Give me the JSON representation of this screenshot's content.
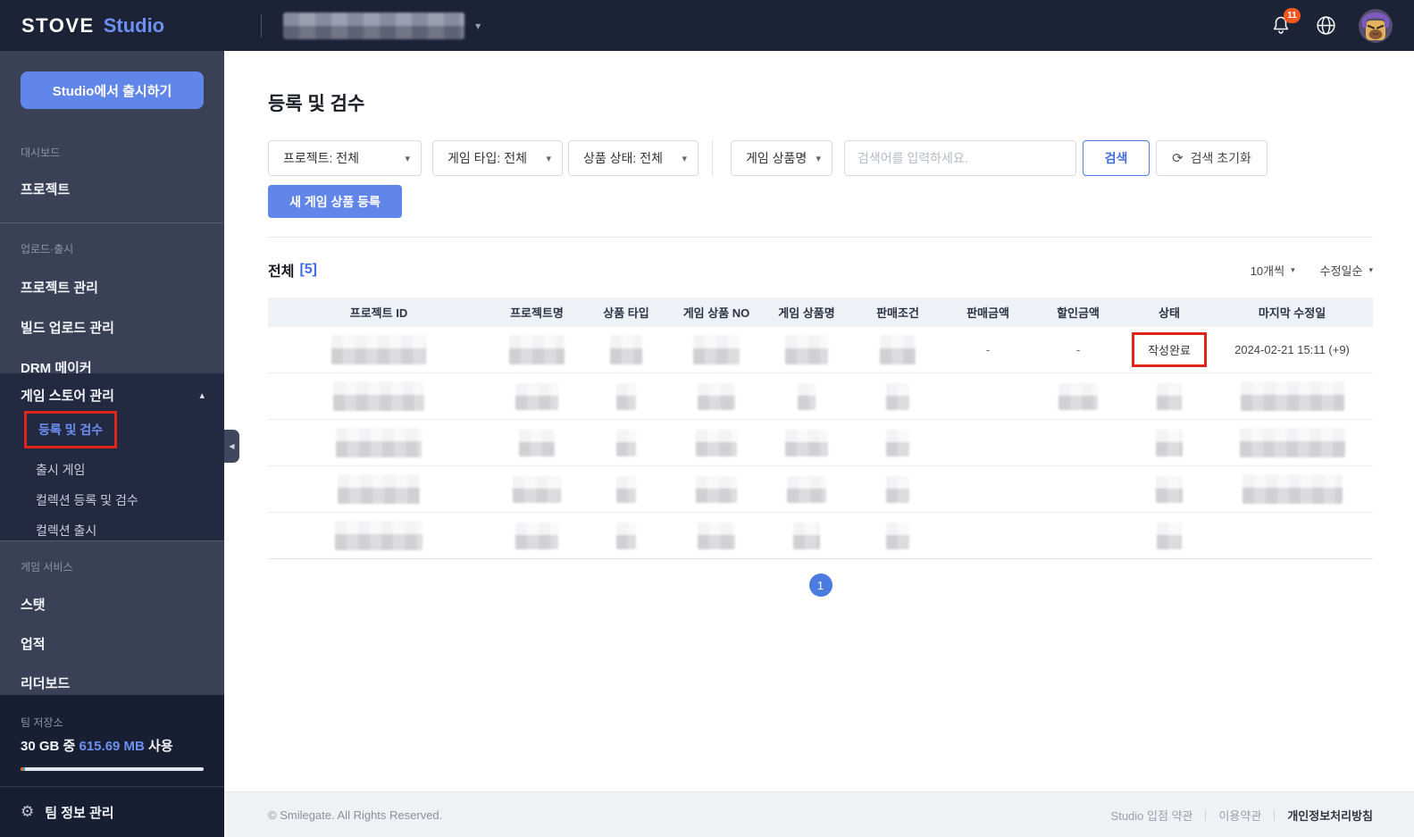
{
  "topbar": {
    "brand_primary": "STOVE",
    "brand_secondary": "Studio",
    "notification_count": "11"
  },
  "sidebar": {
    "publish_button": "Studio에서 출시하기",
    "section_dashboard": "대시보드",
    "item_project": "프로젝트",
    "section_upload": "업로드·출시",
    "item_project_mgmt": "프로젝트 관리",
    "item_build_upload": "빌드 업로드 관리",
    "item_drm_maker": "DRM 메이커",
    "item_game_store": "게임 스토어 관리",
    "item_register_review": "등록 및 검수",
    "item_released_games": "출시 게임",
    "item_collection_register": "컬렉션 등록 및 검수",
    "item_collection_release": "컬렉션 출시",
    "section_game_service": "게임 서비스",
    "item_stat": "스탯",
    "item_achievement": "업적",
    "item_leaderboard": "리더보드",
    "storage_label": "팀 저장소",
    "storage_total_prefix": "30 GB 중",
    "storage_used": "615.69 MB",
    "storage_suffix": "사용",
    "item_team_info": "팀 정보 관리"
  },
  "main": {
    "page_title": "등록 및 검수",
    "filters": {
      "project": "프로젝트: 전체",
      "game_type": "게임 타입: 전체",
      "product_state": "상품 상태: 전체",
      "search_category": "게임 상품명",
      "search_placeholder": "검색어를 입력하세요.",
      "search_button": "검색",
      "reset_button": "검색 초기화"
    },
    "new_product_button": "새 게임 상품 등록",
    "list_bar": {
      "total_label": "전체",
      "total_count": "[5]",
      "page_size": "10개씩",
      "sort_order": "수정일순"
    },
    "table": {
      "headers": [
        "프로젝트 ID",
        "프로젝트명",
        "상품 타입",
        "게임 상품 NO",
        "게임 상품명",
        "판매조건",
        "판매금액",
        "할인금액",
        "상태",
        "마지막 수정일"
      ],
      "row1": {
        "sale_price": "-",
        "discount_price": "-",
        "status": "작성완료",
        "last_modified": "2024-02-21 15:11 (+9)"
      }
    },
    "pagination_page": "1"
  },
  "footer": {
    "copyright": "© Smilegate. All Rights Reserved.",
    "link_studio_terms": "Studio 입점 약관",
    "link_terms": "이용약관",
    "link_privacy": "개인정보처리방침"
  },
  "colors": {
    "accent_blue": "#6186ea",
    "link_blue": "#6d8ff2",
    "annotation_red": "#e0251b",
    "badge_orange": "#f4581f"
  },
  "icons": {
    "caret_down": "▾",
    "caret_up": "▴",
    "collapse_left": "◀",
    "refresh": "⟳",
    "gear": "⚙"
  }
}
